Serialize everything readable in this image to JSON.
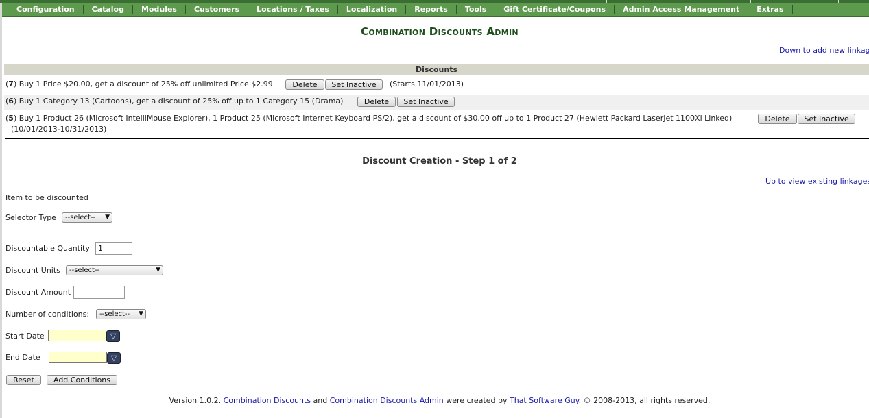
{
  "menu": {
    "items": [
      {
        "label": "Configuration"
      },
      {
        "label": "Catalog"
      },
      {
        "label": "Modules"
      },
      {
        "label": "Customers"
      },
      {
        "label": "Locations / Taxes"
      },
      {
        "label": "Localization"
      },
      {
        "label": "Reports"
      },
      {
        "label": "Tools"
      },
      {
        "label": "Gift Certificate/Coupons"
      },
      {
        "label": "Admin Access Management"
      },
      {
        "label": "Extras"
      }
    ]
  },
  "page": {
    "title": "Combination Discounts Admin",
    "down_link": "Down to add new linkage",
    "up_link": "Up to view existing linkages"
  },
  "discounts": {
    "header": "Discounts",
    "delete_label": "Delete",
    "set_inactive_label": "Set Inactive",
    "rows": [
      {
        "id": "7",
        "text": ") Buy 1 Price $20.00, get a discount of 25% off unlimited Price $2.99",
        "note": "(Starts 11/01/2013)"
      },
      {
        "id": "6",
        "text": ") Buy 1 Category 13 (Cartoons), get a discount of 25% off up to 1 Category 15 (Drama)",
        "note": ""
      },
      {
        "id": "5",
        "text": ") Buy 1 Product 26 (Microsoft IntelliMouse Explorer), 1 Product 25 (Microsoft Internet Keyboard PS/2), get a discount of $30.00 off up to 1 Product 27 (Hewlett Packard LaserJet 1100Xi Linked)",
        "note": "(10/01/2013-10/31/2013)"
      }
    ]
  },
  "form": {
    "section_title": "Discount Creation - Step 1 of 2",
    "item_label": "Item to be discounted",
    "selector_type_label": "Selector Type",
    "selector_type_value": "--select--",
    "quantity_label": "Discountable Quantity",
    "quantity_value": "1",
    "units_label": "Discount Units",
    "units_value": "--select--",
    "amount_label": "Discount Amount",
    "amount_value": "",
    "conditions_label": "Number of conditions:",
    "conditions_value": "--select--",
    "start_date_label": "Start Date",
    "end_date_label": "End Date",
    "reset_label": "Reset",
    "add_conditions_label": "Add Conditions"
  },
  "footer": {
    "prefix": "Version 1.0.2. ",
    "link1": "Combination Discounts",
    "and": " and ",
    "link2": "Combination Discounts Admin",
    "middle": " were created by ",
    "link3": "That Software Guy",
    "suffix": ". © 2008-2013, all rights reserved."
  },
  "colors": {
    "menu_bg": "#5e9a4e",
    "title": "#1f4f1f",
    "link": "#1a1aa6",
    "date_bg": "#ffffcc"
  }
}
